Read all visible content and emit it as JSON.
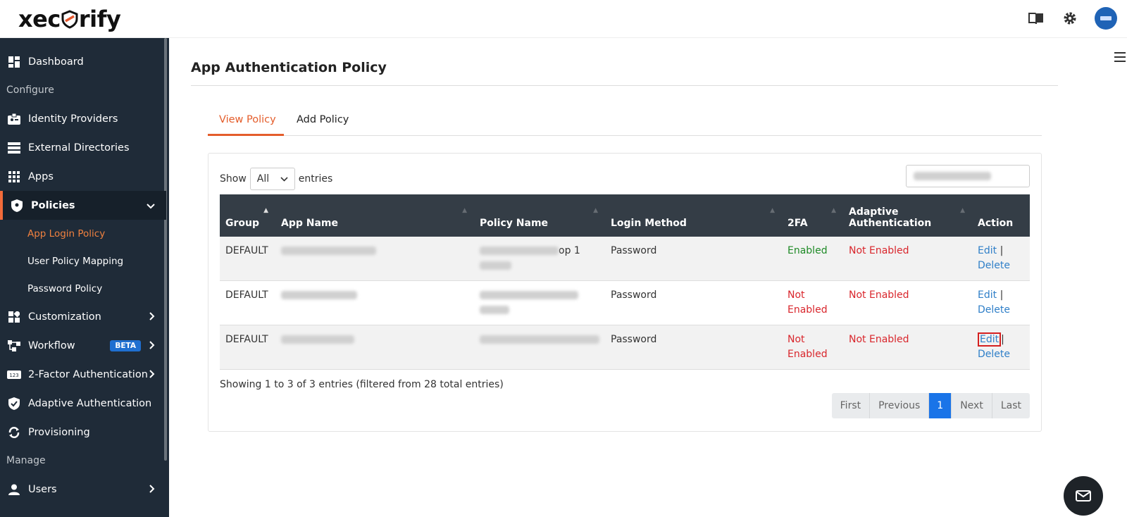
{
  "brand": {
    "logo_text_left": "xec",
    "logo_text_right": "rify"
  },
  "topbar": {
    "icons": [
      "book-icon",
      "gear-icon",
      "avatar"
    ]
  },
  "sidebar": {
    "dashboard": "Dashboard",
    "section_configure": "Configure",
    "identity_providers": "Identity Providers",
    "external_directories": "External Directories",
    "apps": "Apps",
    "policies": "Policies",
    "sub_app_login_policy": "App Login Policy",
    "sub_user_policy_mapping": "User Policy Mapping",
    "sub_password_policy": "Password Policy",
    "customization": "Customization",
    "workflow": "Workflow",
    "workflow_badge": "BETA",
    "two_factor": "2-Factor Authentication",
    "adaptive_auth": "Adaptive Authentication",
    "provisioning": "Provisioning",
    "section_manage": "Manage",
    "users": "Users"
  },
  "main": {
    "title": "App Authentication Policy",
    "tabs": {
      "view": "View Policy",
      "add": "Add Policy"
    },
    "show_label": "Show",
    "show_value": "All",
    "entries_label": "entries",
    "columns": {
      "group": "Group",
      "app_name": "App Name",
      "policy_name": "Policy Name",
      "login_method": "Login Method",
      "twofa": "2FA",
      "adaptive_l1": "Adaptive",
      "adaptive_l2": "Authentication",
      "action": "Action"
    },
    "rows": [
      {
        "group": "DEFAULT",
        "policy_visible": "op 1",
        "login": "Password",
        "twofa": "Enabled",
        "adaptive": "Not Enabled",
        "edit": "Edit",
        "sep": "|",
        "delete": "Delete"
      },
      {
        "group": "DEFAULT",
        "login": "Password",
        "twofa_l1": "Not",
        "twofa_l2": "Enabled",
        "adaptive": "Not Enabled",
        "edit": "Edit",
        "sep": "|",
        "delete": "Delete"
      },
      {
        "group": "DEFAULT",
        "login": "Password",
        "twofa_l1": "Not",
        "twofa_l2": "Enabled",
        "adaptive": "Not Enabled",
        "edit": "Edit",
        "sep": "|",
        "delete": "Delete"
      }
    ],
    "summary": "Showing 1 to 3 of 3 entries (filtered from 28 total entries)",
    "pager": {
      "first": "First",
      "previous": "Previous",
      "current": "1",
      "next": "Next",
      "last": "Last"
    }
  },
  "colors": {
    "accent": "#e45d2b",
    "sidebar_bg": "#1f2b38",
    "header_bg": "#343d46",
    "enabled": "#1e8a26",
    "not_enabled": "#d9262c",
    "link": "#2f7fc8",
    "page_active": "#1a74e8"
  }
}
